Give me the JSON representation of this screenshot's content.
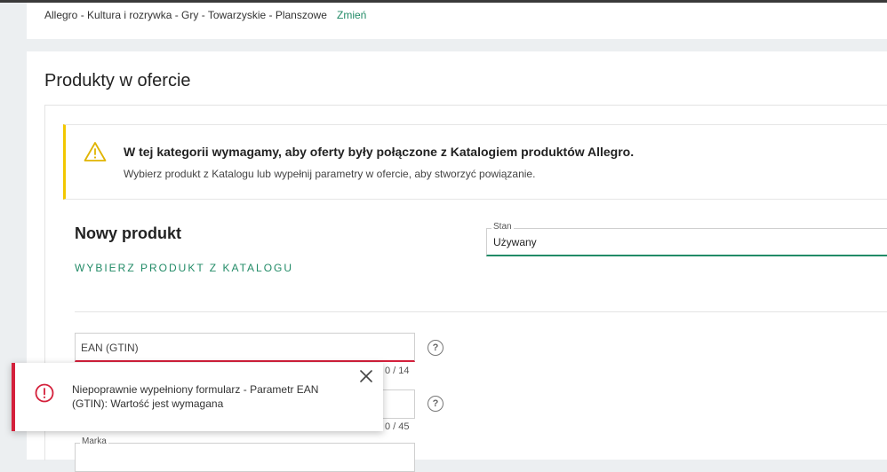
{
  "category_card": {
    "path": "Allegro - Kultura i rozrywka - Gry - Towarzyskie - Planszowe",
    "change_link": "Zmień"
  },
  "products": {
    "section_title": "Produkty w ofercie",
    "alert": {
      "icon": "warning-triangle-icon",
      "title": "W tej kategorii wymagamy, aby oferty były połączone z Katalogiem produktów Allegro.",
      "description": "Wybierz produkt z Katalogu lub wypełnij parametry w ofercie, aby stworzyć powiązanie."
    },
    "new_product_title": "Nowy produkt",
    "catalog_link": "WYBIERZ PRODUKT Z KATALOGU",
    "stan": {
      "label": "Stan",
      "value": "Używany"
    },
    "ean": {
      "placeholder": "EAN (GTIN)",
      "counter": "0 / 14"
    },
    "field2": {
      "counter": "0 / 45"
    },
    "marka": {
      "label": "Marka"
    }
  },
  "toast": {
    "message": "Niepoprawnie wypełniony formularz - Parametr EAN (GTIN): Wartość jest wymagana"
  },
  "colors": {
    "accent_green": "#228b67",
    "error_red": "#d4203b",
    "warning_yellow": "#f2c700"
  }
}
